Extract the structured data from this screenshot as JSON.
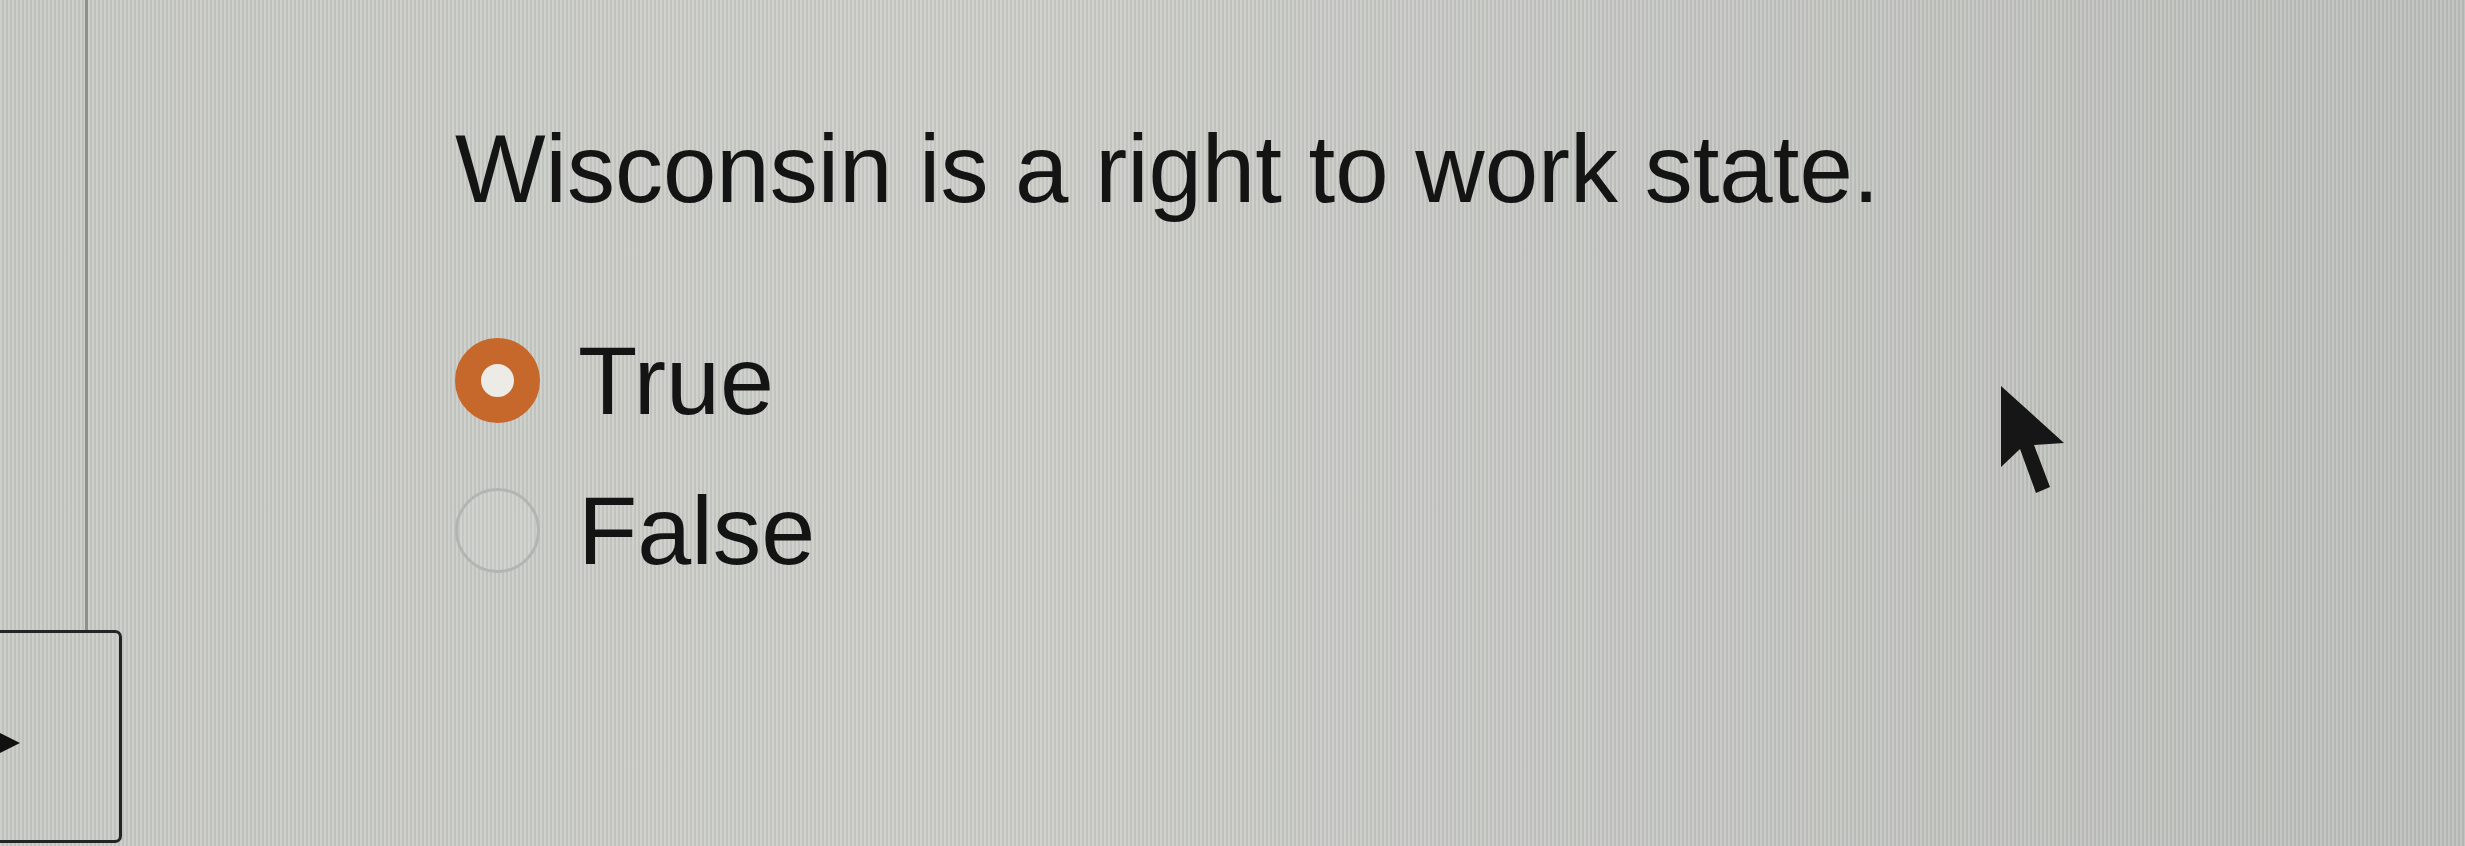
{
  "question": {
    "text": "Wisconsin is a right to work state."
  },
  "options": [
    {
      "label": "True",
      "selected": true
    },
    {
      "label": "False",
      "selected": false
    }
  ]
}
